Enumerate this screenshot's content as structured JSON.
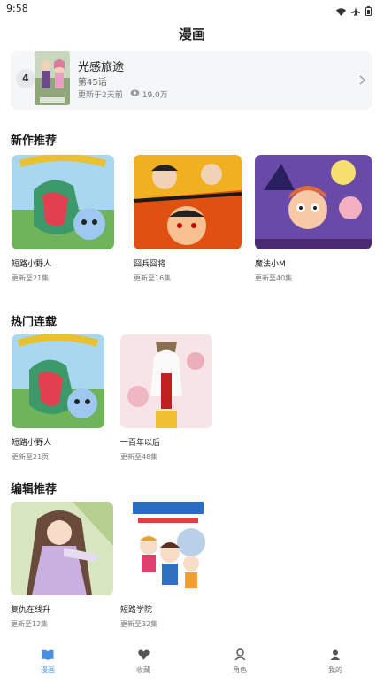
{
  "status": {
    "time": "9:58"
  },
  "header": {
    "title": "漫画"
  },
  "recent": {
    "rank": "4",
    "name": "光感旅途",
    "episode": "第45话",
    "updated": "更新于2天前",
    "views": "19.0万"
  },
  "sections": [
    {
      "title": "新作推荐",
      "items": [
        {
          "title": "短路小野人",
          "subtitle": "更新至21集"
        },
        {
          "title": "囧兵囧将",
          "subtitle": "更新至16集"
        },
        {
          "title": "魔法小M",
          "subtitle": "更新至40集"
        }
      ]
    },
    {
      "title": "热门连载",
      "items": [
        {
          "title": "短路小野人",
          "subtitle": "更新至21页"
        },
        {
          "title": "一百年以后",
          "subtitle": "更新至48集"
        }
      ]
    },
    {
      "title": "编辑推荐",
      "items": [
        {
          "title": "复仇在线升",
          "subtitle": "更新至12集"
        },
        {
          "title": "短路学院",
          "subtitle": "更新至32集"
        }
      ]
    }
  ],
  "tabs": [
    {
      "label": "漫画",
      "icon": "book-icon",
      "active": true
    },
    {
      "label": "收藏",
      "icon": "heart-icon",
      "active": false
    },
    {
      "label": "角色",
      "icon": "character-icon",
      "active": false
    },
    {
      "label": "我的",
      "icon": "user-icon",
      "active": false
    }
  ],
  "colors": {
    "accent": "#4a90e2",
    "card_bg": "#f5f6f8"
  }
}
